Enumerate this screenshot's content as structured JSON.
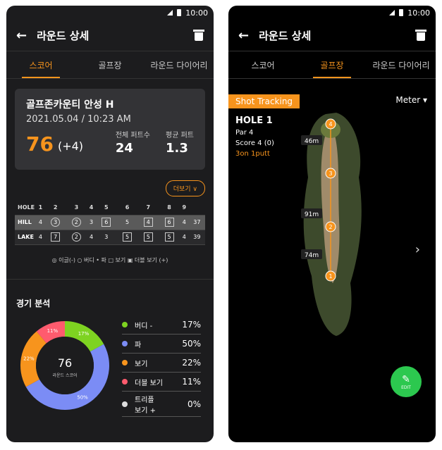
{
  "status": {
    "time": "10:00"
  },
  "appbar": {
    "title": "라운드 상세"
  },
  "tabs": [
    "스코어",
    "골프장",
    "라운드 다이어리"
  ],
  "scorecard": {
    "course": "골프존카운티 안성 H",
    "date": "2021.05.04 / 10:23 AM",
    "score": "76",
    "diff": "(+4)",
    "putts_label": "전체 퍼트수",
    "putts": "24",
    "avg_label": "평균 퍼트",
    "avg": "1.3"
  },
  "more_label": "더보기",
  "table": {
    "header": [
      "HOLE",
      "1",
      "2",
      "3",
      "4",
      "5",
      "6",
      "7",
      "8",
      "9",
      ""
    ],
    "rows": [
      {
        "name": "HILL",
        "cells": [
          {
            "v": "4"
          },
          {
            "v": "3",
            "m": "c"
          },
          {
            "v": "2",
            "m": "c"
          },
          {
            "v": "3"
          },
          {
            "v": "6",
            "m": "s"
          },
          {
            "v": "5"
          },
          {
            "v": "4",
            "m": "s"
          },
          {
            "v": "6",
            "m": "s"
          },
          {
            "v": "4"
          },
          {
            "v": "37"
          }
        ]
      },
      {
        "name": "LAKE",
        "cells": [
          {
            "v": "4"
          },
          {
            "v": "7",
            "m": "s"
          },
          {
            "v": "2",
            "m": "c"
          },
          {
            "v": "4"
          },
          {
            "v": "3"
          },
          {
            "v": "5",
            "m": "s"
          },
          {
            "v": "5",
            "m": "s"
          },
          {
            "v": "5",
            "m": "s"
          },
          {
            "v": "4"
          },
          {
            "v": "39"
          }
        ]
      }
    ]
  },
  "score_legend": "◎ 이글(-)   ○ 버디   • 파   □ 보기   ▣ 더블 보기 (+)",
  "analysis": {
    "title": "경기 분석",
    "total": "76",
    "total_label": "라운드 스코어",
    "items": [
      {
        "label": "버디 -",
        "pct": "17%",
        "value": 17,
        "color": "#7ed321"
      },
      {
        "label": "파",
        "pct": "50%",
        "value": 50,
        "color": "#7b8cf5"
      },
      {
        "label": "보기",
        "pct": "22%",
        "value": 22,
        "color": "#f7941d"
      },
      {
        "label": "더블 보기",
        "pct": "11%",
        "value": 11,
        "color": "#ff5b6e"
      },
      {
        "label": "트리플\n보기 +",
        "pct": "0%",
        "value": 0,
        "color": "#dddddd"
      }
    ]
  },
  "course_view": {
    "shot_label": "Shot Tracking",
    "unit": "Meter",
    "hole": "HOLE 1",
    "par": "Par 4",
    "score": "Score 4 (0)",
    "on": "3on 1putt",
    "distances": [
      "46m",
      "91m",
      "74m"
    ],
    "shots": [
      "4",
      "3",
      "2",
      "1"
    ],
    "edit": "EDIT"
  }
}
